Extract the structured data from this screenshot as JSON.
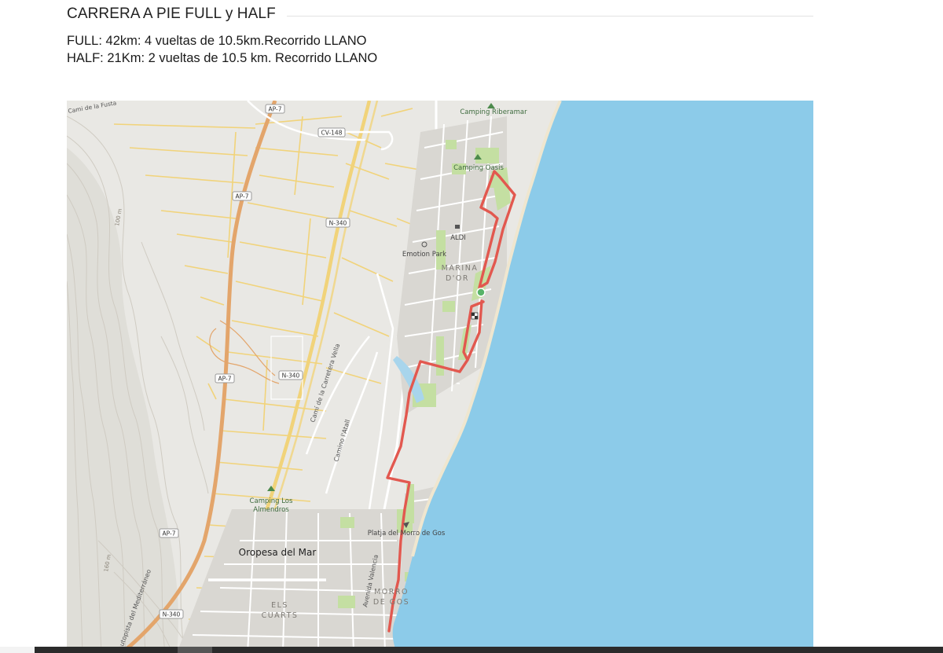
{
  "section": {
    "title": "CARRERA A PIE FULL y HALF",
    "full_line": "FULL: 42km: 4 vueltas de 10.5km.Recorrido LLANO",
    "half_line": "HALF: 21Km: 2 vueltas de 10.5 km. Recorrido LLANO"
  },
  "map": {
    "colors": {
      "sea": "#8ccbe9",
      "land": "#e9e8e4",
      "route": "#e2584f",
      "highway": "#e3a56b",
      "road_yellow": "#f1d37a",
      "park": "#c4dfa2",
      "town": "#d9d7d2",
      "relief": "#cfcbc2",
      "start_marker": "#58b368"
    },
    "place_labels": {
      "oropesa": "Oropesa del Mar",
      "marina_line1": "MARINA",
      "marina_line2": "D'OR",
      "morro_line1": "MORRO",
      "morro_line2": "DE GOS",
      "els_line1": "ELS",
      "els_line2": "CUARTS"
    },
    "poi_labels": {
      "camping_riberamar": "Camping Riberamar",
      "camping_oasis": "Camping Oasis",
      "aldi": "ALDI",
      "emotion_park": "Emotion Park",
      "camping_almendros_line1": "Camping Los",
      "camping_almendros_line2": "Almendros",
      "platja_morro": "Platja del Morro de Gos"
    },
    "road_labels": {
      "cami_fusta": "Cami de la Fusta",
      "cami_carretera_vella": "Camí de la Carretera Vella",
      "camino_atall": "Camino l'Atall",
      "avenida_valencia": "Avenida Valencia",
      "autopista": "Autopista del Mediterráneo",
      "contour_100": "100 m",
      "contour_160": "160 m"
    },
    "road_shields": {
      "ap7": "AP-7",
      "cv148": "CV-148",
      "n340": "N-340"
    }
  }
}
